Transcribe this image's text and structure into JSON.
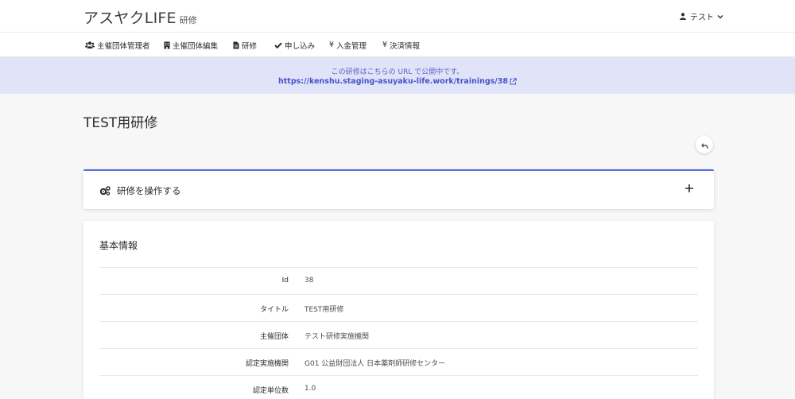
{
  "header": {
    "brand": "アスヤクLIFE",
    "brand_sub": "研修",
    "user_name": "テスト"
  },
  "nav": {
    "items": [
      {
        "label": "主催団体管理者",
        "icon": "users-icon"
      },
      {
        "label": "主催団体編集",
        "icon": "building-icon"
      },
      {
        "label": "研修",
        "icon": "file-icon"
      },
      {
        "label": "申し込み",
        "icon": "check-icon"
      },
      {
        "label": "入金管理",
        "icon": "yen-icon"
      },
      {
        "label": "決済情報",
        "icon": "yen-icon"
      }
    ]
  },
  "banner": {
    "text": "この研修はこちらの URL で公開中です。",
    "url": "https://kenshu.staging-asuyaku-life.work/trainings/38"
  },
  "page": {
    "title": "TEST用研修"
  },
  "ops_card": {
    "title": "研修を操作する"
  },
  "info_card": {
    "title": "基本情報",
    "rows": [
      {
        "label": "Id",
        "value": "38"
      },
      {
        "label": "タイトル",
        "value": "TEST用研修"
      },
      {
        "label": "主催団体",
        "value": "テスト研修実施機関"
      },
      {
        "label": "認定実施機関",
        "value": "G01 公益財団法人 日本薬剤師研修センター"
      },
      {
        "label": "認定単位数",
        "value": "1.0"
      }
    ]
  },
  "colors": {
    "accent": "#5d6ee0",
    "banner_bg": "#e1e4f8",
    "link": "#4654c8"
  }
}
